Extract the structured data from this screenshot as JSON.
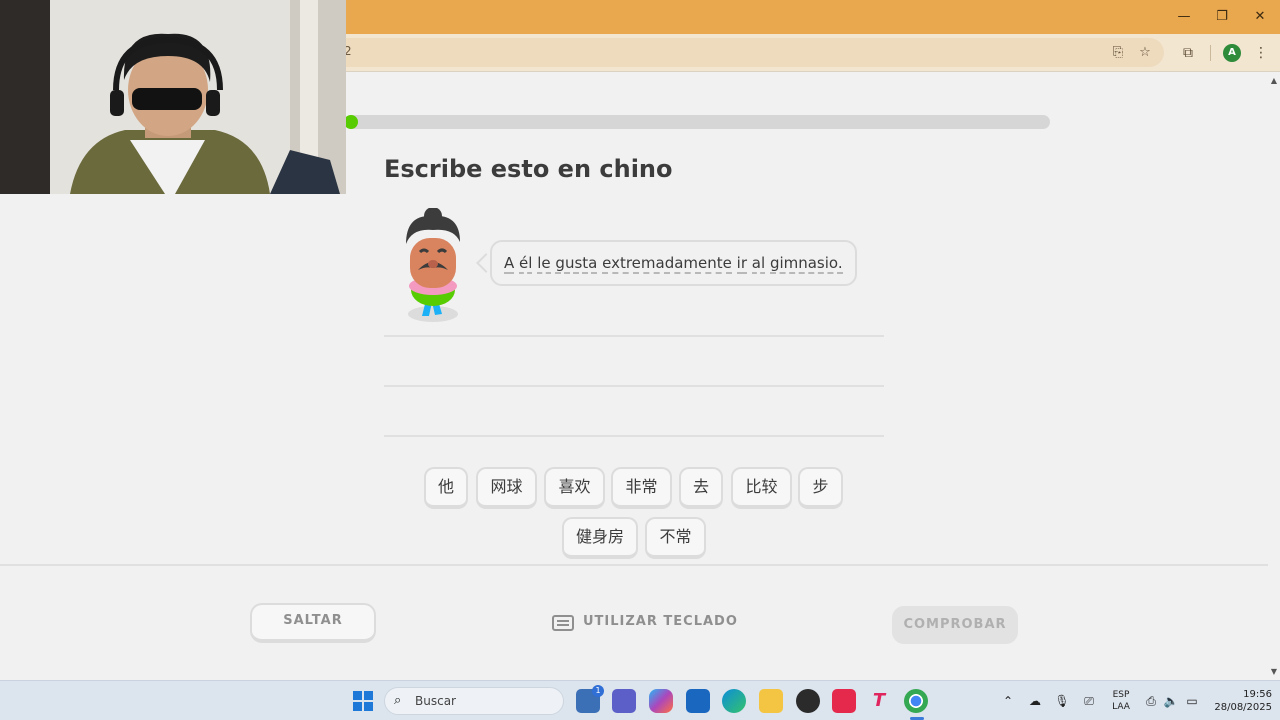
{
  "browser": {
    "url_fragment": "2",
    "window_controls": {
      "minimize": "—",
      "restore": "❐",
      "close": "✕"
    },
    "profile_initial": "A"
  },
  "lesson": {
    "progress": 0.01,
    "title": "Escribe esto en chino",
    "prompt_words": [
      "A",
      "él",
      "le",
      "gusta",
      "extremadamente",
      "ir",
      "al",
      "gimnasio."
    ],
    "word_bank_row1": [
      "他",
      "网球",
      "喜欢",
      "非常",
      "去",
      "比较",
      "步"
    ],
    "word_bank_row2": [
      "健身房",
      "不常"
    ]
  },
  "footer": {
    "skip_label": "SALTAR",
    "keyboard_label": "UTILIZAR TECLADO",
    "check_label": "COMPROBAR"
  },
  "taskbar": {
    "search_placeholder": "Buscar",
    "lang_line1": "ESP",
    "lang_line2": "LAA",
    "time": "19:56",
    "date": "28/08/2025",
    "store_badge": "1"
  },
  "colors": {
    "titlebar": "#e9a74e",
    "progress": "#58cc02",
    "text": "#3c3c3c"
  }
}
